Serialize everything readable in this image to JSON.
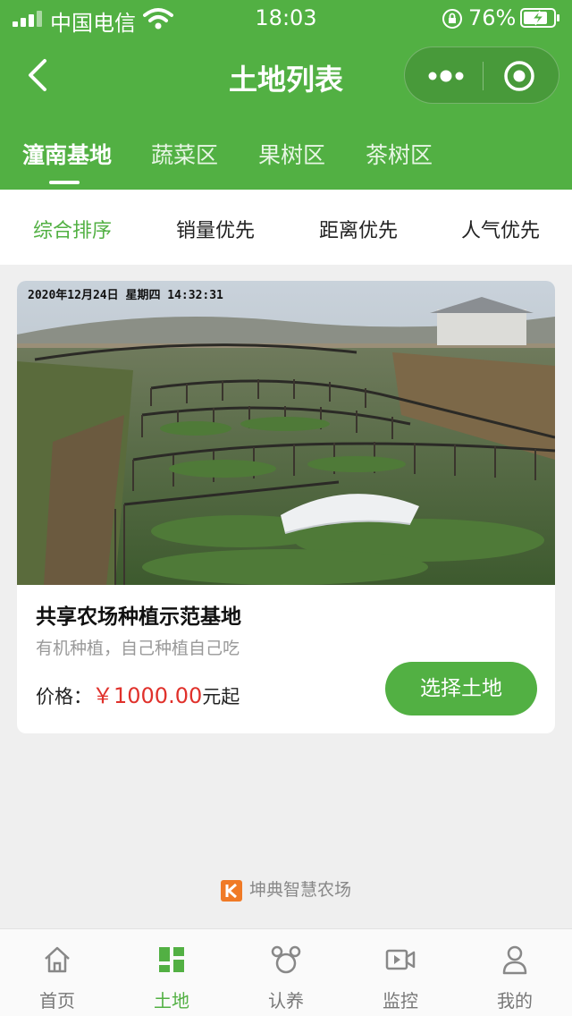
{
  "status_bar": {
    "carrier": "中国电信",
    "time": "18:03",
    "battery": "76%"
  },
  "nav": {
    "title": "土地列表",
    "back_icon": "chevron-left-icon",
    "more_icon": "more-dots-icon",
    "close_icon": "target-icon"
  },
  "tabs": [
    {
      "label": "潼南基地",
      "active": true
    },
    {
      "label": "蔬菜区"
    },
    {
      "label": "果树区"
    },
    {
      "label": "茶树区"
    }
  ],
  "sort": [
    {
      "label": "综合排序",
      "active": true
    },
    {
      "label": "销量优先"
    },
    {
      "label": "距离优先"
    },
    {
      "label": "人气优先"
    }
  ],
  "card": {
    "photo_timestamp": "2020年12月24日  星期四  14:32:31",
    "title": "共享农场种植示范基地",
    "subtitle": "有机种植，自己种植自己吃",
    "price_label": "价格：",
    "price_amount": "￥1000.00",
    "price_suffix": "元起",
    "button": "选择土地"
  },
  "brand": {
    "text": "坤典智慧农场"
  },
  "tabbar": [
    {
      "label": "首页",
      "icon": "home-icon"
    },
    {
      "label": "土地",
      "icon": "grid-icon",
      "active": true
    },
    {
      "label": "认养",
      "icon": "adopt-icon"
    },
    {
      "label": "监控",
      "icon": "video-camera-icon"
    },
    {
      "label": "我的",
      "icon": "user-icon"
    }
  ],
  "colors": {
    "primary": "#52b043",
    "price": "#e0312b",
    "background": "#efefef"
  }
}
